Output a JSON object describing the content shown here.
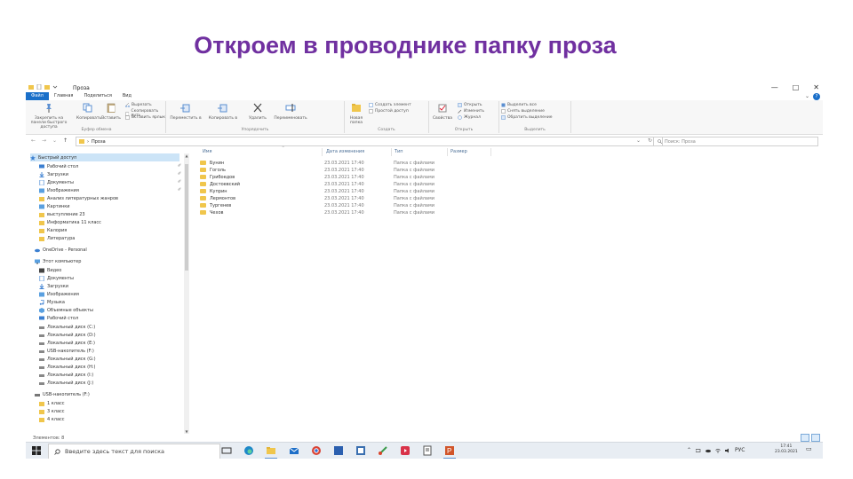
{
  "slide": {
    "title": "Откроем в проводнике папку проза"
  },
  "window": {
    "title": "Проза",
    "controls": {
      "minimize": "—",
      "maximize": "□",
      "close": "✕"
    },
    "help": "?",
    "expand": "⌄"
  },
  "tabs": [
    "Файл",
    "Главная",
    "Поделиться",
    "Вид"
  ],
  "ribbon": {
    "clipboard": {
      "pin_label": "Закрепить на панели быстрого доступа",
      "copy_label": "Копировать",
      "paste_label": "Вставить",
      "cut": "Вырезать",
      "copy_path": "Скопировать путь",
      "paste_shortcut": "Вставить ярлык",
      "group": "Буфер обмена"
    },
    "organize": {
      "move_to": "Переместить в",
      "copy_to": "Копировать в",
      "delete": "Удалить",
      "rename": "Переименовать",
      "group": "Упорядочить"
    },
    "new": {
      "new_folder": "Новая папка",
      "new_item": "Создать элемент",
      "easy_access": "Простой доступ",
      "group": "Создать"
    },
    "open": {
      "properties": "Свойства",
      "open": "Открыть",
      "edit": "Изменить",
      "history": "Журнал",
      "group": "Открыть"
    },
    "select": {
      "select_all": "Выделить все",
      "select_none": "Снять выделение",
      "invert": "Обратить выделение",
      "group": "Выделить"
    }
  },
  "address": {
    "back": "←",
    "forward": "→",
    "recent": "⌄",
    "up": "↑",
    "sep": "›",
    "path": "Проза",
    "dropdown": "⌄",
    "refresh": "↻",
    "search_placeholder": "Поиск: Проза"
  },
  "nav": {
    "quick_access": "Быстрый доступ",
    "quick_items": [
      "Рабочий стол",
      "Загрузки",
      "Документы",
      "Изображения",
      "Анализ литературных жанров",
      "Картинки",
      "выступление 23",
      "Информатика 11 класс",
      "Калория",
      "Литература"
    ],
    "pin_glyph": "✐",
    "onedrive": "OneDrive - Personal",
    "this_pc": "Этот компьютер",
    "pc_items": [
      "Видео",
      "Документы",
      "Загрузки",
      "Изображения",
      "Музыка",
      "Объемные объекты",
      "Рабочий стол"
    ],
    "drives": [
      "Локальный диск (C:)",
      "Локальный диск (D:)",
      "Локальный диск (E:)",
      "USB-накопитель (F:)",
      "Локальный диск (G:)",
      "Локальный диск (H:)",
      "Локальный диск (I:)",
      "Локальный диск (J:)"
    ],
    "usb": "USB-накопитель (F:)",
    "usb_items": [
      "1 класс",
      "3 класс",
      "4 класс"
    ],
    "scroll_up": "▲",
    "scroll_down": "▼"
  },
  "columns": {
    "name": "Имя",
    "date": "Дата изменения",
    "type": "Тип",
    "size": "Размер",
    "sort": "^"
  },
  "files": [
    {
      "name": "Бунин",
      "date": "23.03.2021 17:40",
      "type": "Папка с файлами"
    },
    {
      "name": "Гоголь",
      "date": "23.03.2021 17:40",
      "type": "Папка с файлами"
    },
    {
      "name": "Грибоедов",
      "date": "23.03.2021 17:40",
      "type": "Папка с файлами"
    },
    {
      "name": "Достоевский",
      "date": "23.03.2021 17:40",
      "type": "Папка с файлами"
    },
    {
      "name": "Куприн",
      "date": "23.03.2021 17:40",
      "type": "Папка с файлами"
    },
    {
      "name": "Лермонтов",
      "date": "23.03.2021 17:40",
      "type": "Папка с файлами"
    },
    {
      "name": "Тургенев",
      "date": "23.03.2021 17:40",
      "type": "Папка с файлами"
    },
    {
      "name": "Чехов",
      "date": "23.03.2021 17:40",
      "type": "Папка с файлами"
    }
  ],
  "status": "Элементов: 8",
  "taskbar": {
    "search_placeholder": "Введите здесь текст для поиска",
    "lang": "РУС",
    "time": "17:41",
    "date": "23.03.2021",
    "tray_arrow": "⌃",
    "notify": "▭"
  },
  "colors": {
    "title": "#7030a0",
    "accent": "#1a6fc9",
    "folder": "#f0c64c"
  }
}
